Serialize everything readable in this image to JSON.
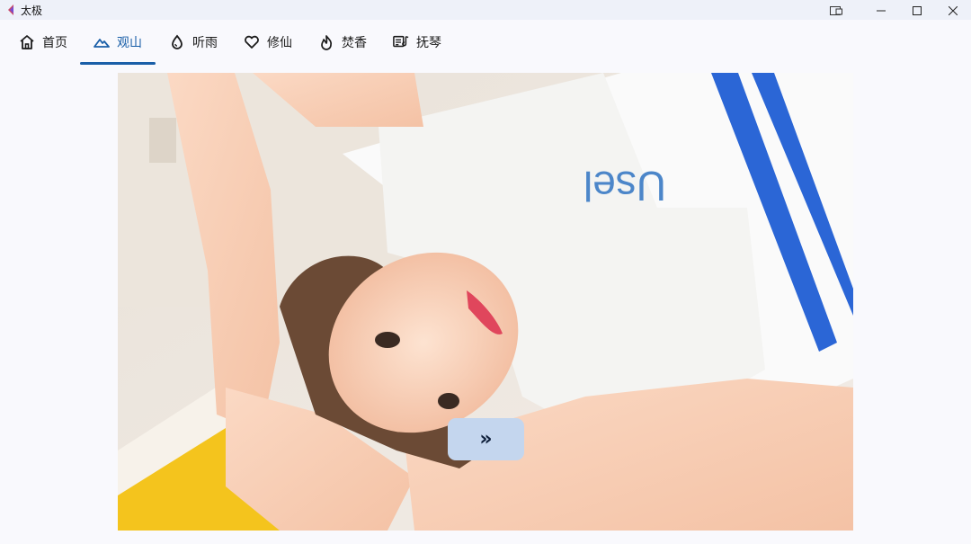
{
  "window": {
    "title": "太极",
    "controls": [
      "cast-icon",
      "minimize-icon",
      "maximize-icon",
      "close-icon"
    ]
  },
  "nav": {
    "active_index": 1,
    "tabs": [
      {
        "label": "首页",
        "icon": "home-icon"
      },
      {
        "label": "观山",
        "icon": "mountain-icon"
      },
      {
        "label": "听雨",
        "icon": "raindrop-icon"
      },
      {
        "label": "修仙",
        "icon": "heart-icon"
      },
      {
        "label": "焚香",
        "icon": "flame-icon"
      },
      {
        "label": "抚琴",
        "icon": "music-note-icon"
      }
    ]
  },
  "viewer": {
    "image_alt": "",
    "next_label": "»"
  },
  "colors": {
    "accent": "#1a5fa8",
    "titlebar_bg": "#eef1f9",
    "page_bg": "#f9f9fd",
    "button_bg": "#c4d6ee"
  }
}
